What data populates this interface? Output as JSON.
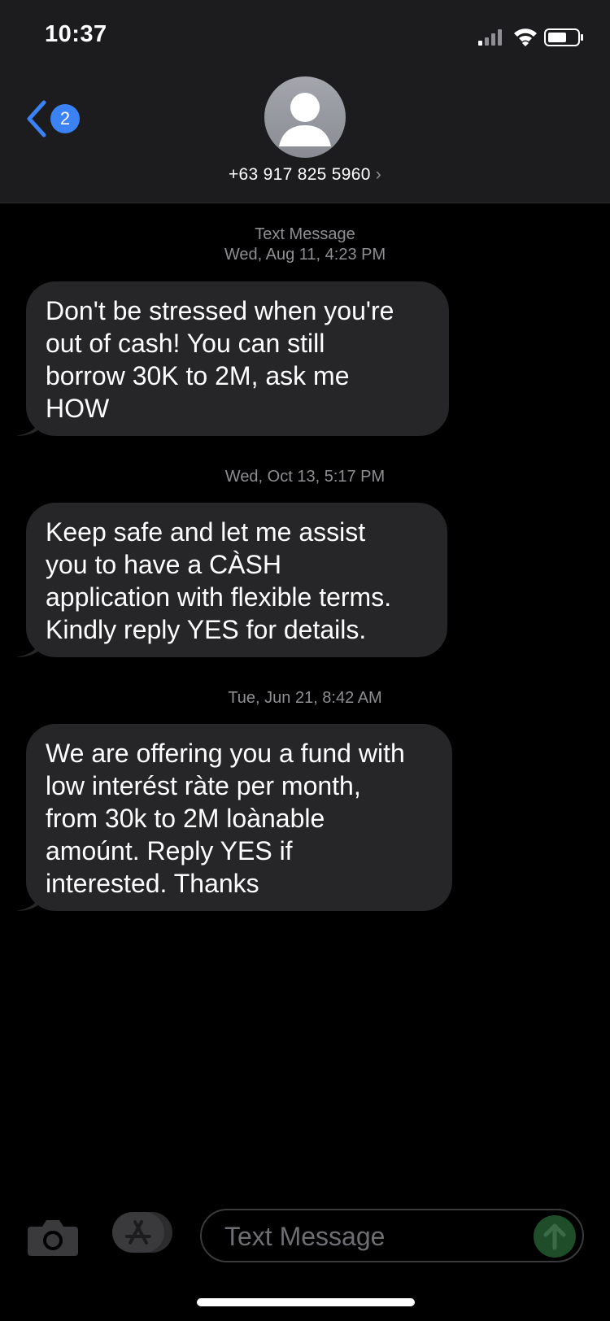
{
  "status_bar": {
    "time": "10:37",
    "icons": [
      "signal-icon",
      "wifi-icon",
      "battery-icon"
    ]
  },
  "header": {
    "back_badge": "2",
    "contact": "+63 917 825 5960",
    "chevron": "›"
  },
  "conversation": {
    "service_label": "Text Message",
    "messages": [
      {
        "timestamp": "Wed, Aug 11, 4:23 PM",
        "lines": [
          "Don't be stressed when you're",
          "out of cash! You can still",
          "borrow 30K to 2M, ask me",
          "HOW"
        ]
      },
      {
        "timestamp": "Wed, Oct 13, 5:17 PM",
        "lines": [
          "Keep safe and let me assist",
          "you to have a CÀSH",
          "application with flexible terms.",
          "Kindly reply YES for details."
        ]
      },
      {
        "timestamp": "Tue, Jun 21, 8:42 AM",
        "lines": [
          "We are offering you a fund with",
          "low interést ràte per month,",
          "from 30k to 2M loànable",
          "amoúnt. Reply YES if",
          "interested. Thanks"
        ]
      }
    ]
  },
  "composer": {
    "placeholder": "Text Message"
  },
  "colors": {
    "accent": "#3b82f6",
    "bubble": "#262628",
    "header_bg": "#1c1c1e",
    "meta_text": "#8e8e93",
    "send_button": "#1f4d2a"
  }
}
